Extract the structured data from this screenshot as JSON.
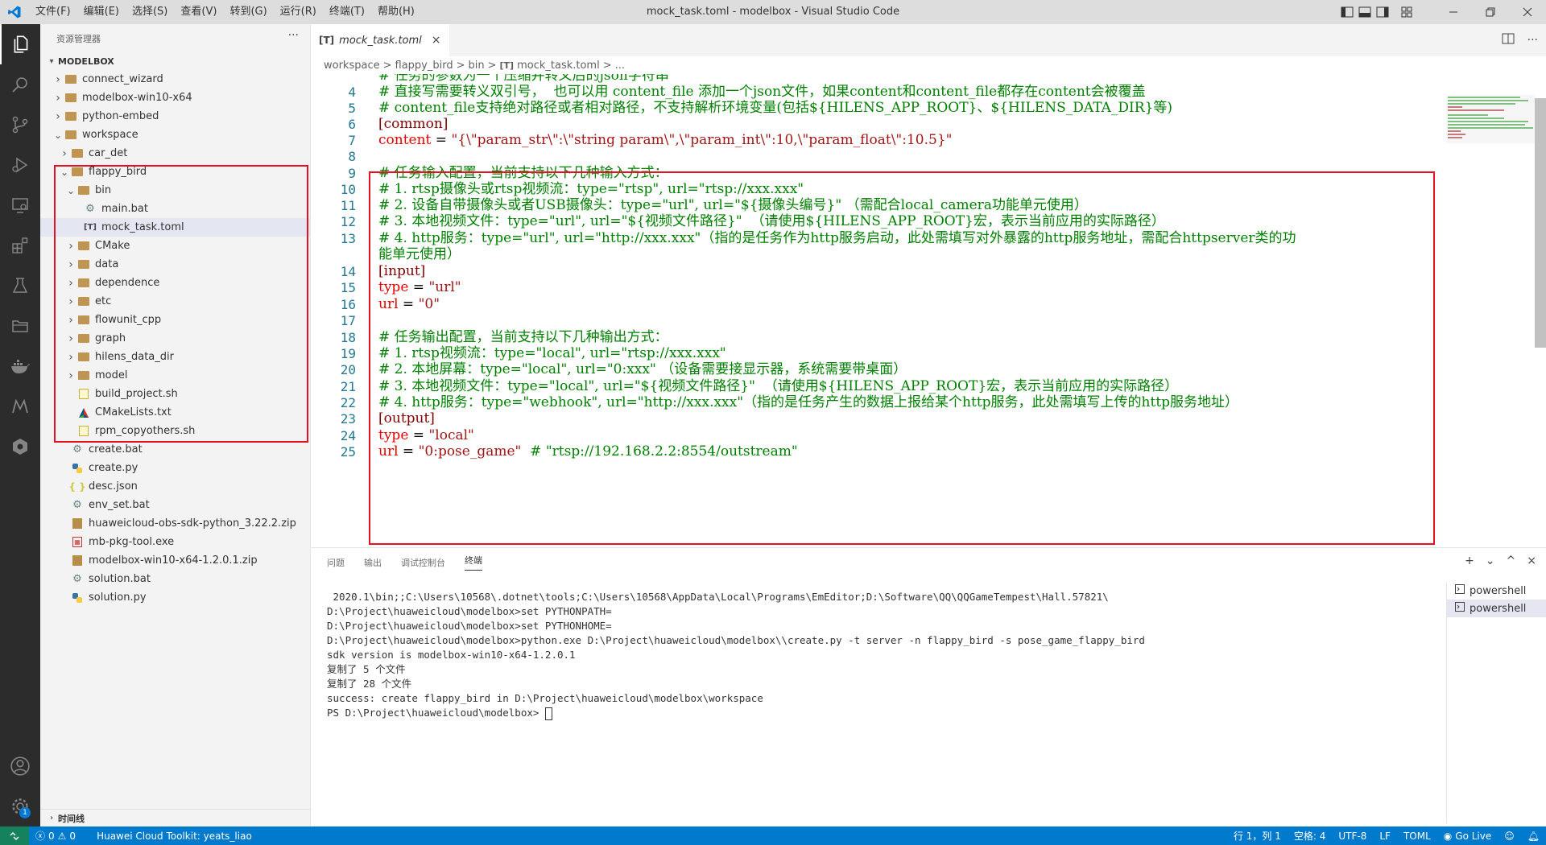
{
  "window": {
    "title": "mock_task.toml - modelbox - Visual Studio Code",
    "menu": [
      "文件(F)",
      "编辑(E)",
      "选择(S)",
      "查看(V)",
      "转到(G)",
      "运行(R)",
      "终端(T)",
      "帮助(H)"
    ]
  },
  "activity_bar": {
    "items": [
      "explorer-icon",
      "search-icon",
      "source-control-icon",
      "run-debug-icon",
      "remote-explorer-icon",
      "extensions-icon",
      "testing-icon",
      "folder-icon",
      "docker-icon",
      "modelarts-icon",
      "huawei-cloud-icon"
    ],
    "bottom": [
      "account-icon",
      "settings-icon"
    ],
    "settings_badge": "1"
  },
  "sidebar": {
    "header": "资源管理器",
    "more": "···",
    "root": "MODELBOX",
    "bottom_section": "时间线",
    "tree": [
      {
        "label": "connect_wizard",
        "type": "folder",
        "depth": 1,
        "expanded": false
      },
      {
        "label": "modelbox-win10-x64",
        "type": "folder",
        "depth": 1,
        "expanded": false
      },
      {
        "label": "python-embed",
        "type": "folder",
        "depth": 1,
        "expanded": false
      },
      {
        "label": "workspace",
        "type": "folder",
        "depth": 1,
        "expanded": true
      },
      {
        "label": "car_det",
        "type": "folder",
        "depth": 2,
        "expanded": false
      },
      {
        "label": "flappy_bird",
        "type": "folder",
        "depth": 2,
        "expanded": true
      },
      {
        "label": "bin",
        "type": "folder-bin",
        "depth": 3,
        "expanded": true
      },
      {
        "label": "main.bat",
        "type": "gear",
        "depth": 4
      },
      {
        "label": "mock_task.toml",
        "type": "toml",
        "depth": 4,
        "selected": true
      },
      {
        "label": "CMake",
        "type": "cmake-folder",
        "depth": 3,
        "expanded": false
      },
      {
        "label": "data",
        "type": "folder",
        "depth": 3,
        "expanded": false
      },
      {
        "label": "dependence",
        "type": "folder",
        "depth": 3,
        "expanded": false
      },
      {
        "label": "etc",
        "type": "folder",
        "depth": 3,
        "expanded": false
      },
      {
        "label": "flowunit_cpp",
        "type": "folder",
        "depth": 3,
        "expanded": false
      },
      {
        "label": "graph",
        "type": "folder",
        "depth": 3,
        "expanded": false
      },
      {
        "label": "hilens_data_dir",
        "type": "folder",
        "depth": 3,
        "expanded": false
      },
      {
        "label": "model",
        "type": "model-folder",
        "depth": 3,
        "expanded": false
      },
      {
        "label": "build_project.sh",
        "type": "sh",
        "depth": 3
      },
      {
        "label": "CMakeLists.txt",
        "type": "cmake",
        "depth": 3
      },
      {
        "label": "rpm_copyothers.sh",
        "type": "sh",
        "depth": 3
      },
      {
        "label": "create.bat",
        "type": "gear",
        "depth": 2
      },
      {
        "label": "create.py",
        "type": "python",
        "depth": 2
      },
      {
        "label": "desc.json",
        "type": "json",
        "depth": 2
      },
      {
        "label": "env_set.bat",
        "type": "gear",
        "depth": 2
      },
      {
        "label": "huaweicloud-obs-sdk-python_3.22.2.zip",
        "type": "zip",
        "depth": 2
      },
      {
        "label": "mb-pkg-tool.exe",
        "type": "exe",
        "depth": 2
      },
      {
        "label": "modelbox-win10-x64-1.2.0.1.zip",
        "type": "zip",
        "depth": 2
      },
      {
        "label": "solution.bat",
        "type": "gear",
        "depth": 2
      },
      {
        "label": "solution.py",
        "type": "python",
        "depth": 2
      }
    ]
  },
  "editor": {
    "tab": {
      "icon": "[T]",
      "label": "mock_task.toml",
      "close": "×"
    },
    "breadcrumbs": [
      "workspace",
      ">",
      "flappy_bird",
      ">",
      "bin",
      ">",
      "[T]",
      "mock_task.toml",
      ">",
      "..."
    ],
    "lines": [
      {
        "n": "",
        "text": "# 任务的参数为一个压缩并转义后的json字符串",
        "kind": "comment"
      },
      {
        "n": "4",
        "text": "# 直接写需要转义双引号，  也可以用 content_file 添加一个json文件，如果content和content_file都存在content会被覆盖",
        "kind": "comment"
      },
      {
        "n": "5",
        "text": "# content_file支持绝对路径或者相对路径，不支持解析环境变量(包括${HILENS_APP_ROOT}、${HILENS_DATA_DIR}等)",
        "kind": "comment"
      },
      {
        "n": "6",
        "text": "[common]",
        "kind": "section"
      },
      {
        "n": "7",
        "key": "content",
        "op": " = ",
        "val": "\"{\\\"param_str\\\":\\\"string param\\\",\\\"param_int\\\":10,\\\"param_float\\\":10.5}\"",
        "kind": "kv"
      },
      {
        "n": "8",
        "text": "",
        "kind": "blank"
      },
      {
        "n": "9",
        "text": "# 任务输入配置，当前支持以下几种输入方式：",
        "kind": "comment"
      },
      {
        "n": "10",
        "text": "# 1. rtsp摄像头或rtsp视频流：type=\"rtsp\", url=\"rtsp://xxx.xxx\"",
        "kind": "comment"
      },
      {
        "n": "11",
        "text": "# 2. 设备自带摄像头或者USB摄像头：type=\"url\", url=\"${摄像头编号}\" （需配合local_camera功能单元使用）",
        "kind": "comment"
      },
      {
        "n": "12",
        "text": "# 3. 本地视频文件：type=\"url\", url=\"${视频文件路径}\"  （请使用${HILENS_APP_ROOT}宏，表示当前应用的实际路径）",
        "kind": "comment"
      },
      {
        "n": "13",
        "text": "# 4. http服务：type=\"url\", url=\"http://xxx.xxx\"（指的是任务作为http服务启动，此处需填写对外暴露的http服务地址，需配合httpserver类的功",
        "kind": "comment"
      },
      {
        "n": "",
        "text": "能单元使用）",
        "kind": "comment"
      },
      {
        "n": "14",
        "text": "[input]",
        "kind": "section"
      },
      {
        "n": "15",
        "key": "type",
        "op": " = ",
        "val": "\"url\"",
        "kind": "kv"
      },
      {
        "n": "16",
        "key": "url",
        "op": " = ",
        "val": "\"0\"",
        "kind": "kv"
      },
      {
        "n": "17",
        "text": "",
        "kind": "blank"
      },
      {
        "n": "18",
        "text": "# 任务输出配置，当前支持以下几种输出方式：",
        "kind": "comment"
      },
      {
        "n": "19",
        "text": "# 1. rtsp视频流：type=\"local\", url=\"rtsp://xxx.xxx\"",
        "kind": "comment"
      },
      {
        "n": "20",
        "text": "# 2. 本地屏幕：type=\"local\", url=\"0:xxx\" （设备需要接显示器，系统需要带桌面）",
        "kind": "comment"
      },
      {
        "n": "21",
        "text": "# 3. 本地视频文件：type=\"local\", url=\"${视频文件路径}\"  （请使用${HILENS_APP_ROOT}宏，表示当前应用的实际路径）",
        "kind": "comment"
      },
      {
        "n": "22",
        "text": "# 4. http服务：type=\"webhook\", url=\"http://xxx.xxx\"（指的是任务产生的数据上报给某个http服务，此处需填写上传的http服务地址）",
        "kind": "comment"
      },
      {
        "n": "23",
        "text": "[output]",
        "kind": "section"
      },
      {
        "n": "24",
        "key": "type",
        "op": " = ",
        "val": "\"local\"",
        "kind": "kv"
      },
      {
        "n": "25",
        "key": "url",
        "op": " = ",
        "val": "\"0:pose_game\"",
        "comment": "  # \"rtsp://192.168.2.2:8554/outstream\"",
        "kind": "kv"
      }
    ]
  },
  "panel": {
    "tabs": [
      "问题",
      "输出",
      "调试控制台",
      "终端"
    ],
    "active_tab": "终端",
    "actions": [
      "+",
      "⌄",
      "^",
      "×"
    ],
    "terminal_lines": [
      " 2020.1\\bin;;C:\\Users\\10568\\.dotnet\\tools;C:\\Users\\10568\\AppData\\Local\\Programs\\EmEditor;D:\\Software\\QQ\\QQGameTempest\\Hall.57821\\",
      "",
      "D:\\Project\\huaweicloud\\modelbox>set PYTHONPATH=",
      "",
      "D:\\Project\\huaweicloud\\modelbox>set PYTHONHOME=",
      "",
      "D:\\Project\\huaweicloud\\modelbox>python.exe D:\\Project\\huaweicloud\\modelbox\\\\create.py -t server -n flappy_bird -s pose_game_flappy_bird",
      "sdk version is modelbox-win10-x64-1.2.0.1",
      "复制了 5 个文件",
      "复制了 28 个文件",
      "success: create flappy_bird in D:\\Project\\huaweicloud\\modelbox\\workspace",
      "PS D:\\Project\\huaweicloud\\modelbox> "
    ],
    "terminals": [
      "powershell",
      "powershell"
    ]
  },
  "statusbar": {
    "errors": "0",
    "warnings": "0",
    "toolkit": "Huawei Cloud Toolkit: yeats_liao",
    "position": "行 1，列 1",
    "spaces": "空格: 4",
    "encoding": "UTF-8",
    "eol": "LF",
    "language": "TOML",
    "golive": "Go Live"
  }
}
